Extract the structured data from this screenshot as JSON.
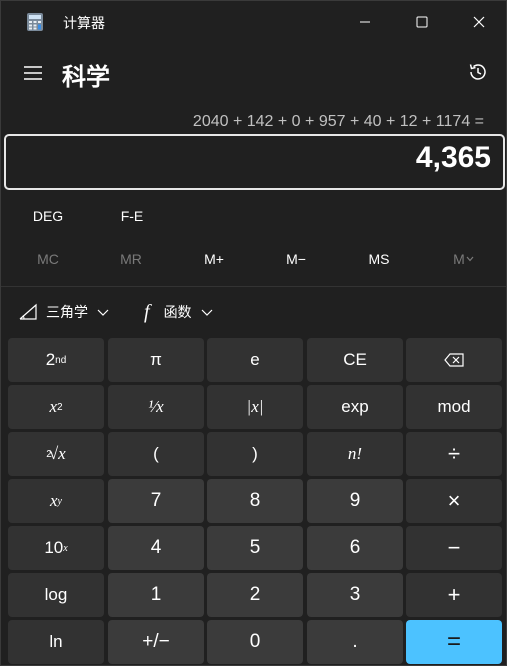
{
  "window": {
    "title": "计算器"
  },
  "header": {
    "mode_title": "科学"
  },
  "display": {
    "expression": "2040 + 142 + 0 + 957 + 40 + 12 + 1174 =",
    "value": "4,365"
  },
  "settings": {
    "angle_unit": "DEG",
    "notation": "F-E"
  },
  "memory": {
    "mc": "MC",
    "mr": "MR",
    "m_plus": "M+",
    "m_minus": "M−",
    "ms": "MS",
    "m_list": "M"
  },
  "functions": {
    "trig": "三角学",
    "func": "函数",
    "func_symbol": "f"
  },
  "keys": {
    "row1": [
      "2nd",
      "π",
      "e",
      "CE",
      "backspace"
    ],
    "row2": [
      "x²",
      "¹⁄x",
      "|x|",
      "exp",
      "mod"
    ],
    "row3": [
      "²√x",
      "(",
      ")",
      "n!",
      "÷"
    ],
    "row4": [
      "xʸ",
      "7",
      "8",
      "9",
      "×"
    ],
    "row5": [
      "10ˣ",
      "4",
      "5",
      "6",
      "−"
    ],
    "row6": [
      "log",
      "1",
      "2",
      "3",
      "+"
    ],
    "row7": [
      "ln",
      "⁺∕₋",
      "0",
      ".",
      "="
    ]
  },
  "key_labels": {
    "two_nd_base": "2",
    "two_nd_sup": "nd",
    "pi": "π",
    "e": "e",
    "ce": "CE",
    "x": "x",
    "sq_sup": "2",
    "one_over_x": "¹⁄x",
    "abs": "|x|",
    "exp": "exp",
    "mod": "mod",
    "root_index": "2",
    "root_sym": "√x",
    "lparen": "(",
    "rparen": ")",
    "factorial": "n!",
    "divide": "÷",
    "y_sup": "y",
    "seven": "7",
    "eight": "8",
    "nine": "9",
    "multiply": "×",
    "ten_base": "10",
    "ten_sup": "x",
    "four": "4",
    "five": "5",
    "six": "6",
    "minus": "−",
    "log": "log",
    "one": "1",
    "two": "2",
    "three": "3",
    "plus": "+",
    "ln": "ln",
    "negate": "+/−",
    "zero": "0",
    "dot": ".",
    "equals": "="
  },
  "colors": {
    "background": "#202020",
    "func_key": "#323232",
    "num_key": "#3b3b3b",
    "accent": "#4cc2ff"
  }
}
